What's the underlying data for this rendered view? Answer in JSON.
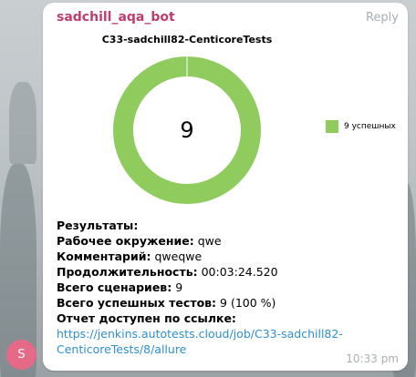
{
  "message": {
    "sender": "sadchill_aqa_bot",
    "reply_label": "Reply",
    "time": "10:33 pm",
    "avatar_letter": "S"
  },
  "chart_data": {
    "type": "pie",
    "title": "C33-sadchill82-CenticoreTests",
    "center_label": "9",
    "categories": [
      "9 успешных"
    ],
    "values": [
      9
    ],
    "colors": [
      "#8fcb5d"
    ],
    "legend_position": "right"
  },
  "results": {
    "header": "Результаты:",
    "env_label": "Рабочее окружение:",
    "env_value": "qwe",
    "comment_label": "Комментарий:",
    "comment_value": "qweqwe",
    "duration_label": "Продолжительность:",
    "duration_value": "00:03:24.520",
    "scenarios_label": "Всего сценариев:",
    "scenarios_value": "9",
    "passed_label": "Всего успешных тестов:",
    "passed_value": "9 (100 %)",
    "report_label": "Отчет доступен по ссылке:",
    "report_link": "https://jenkins.autotests.cloud/job/C33-sadchill82-CenticoreTests/8/allure"
  }
}
